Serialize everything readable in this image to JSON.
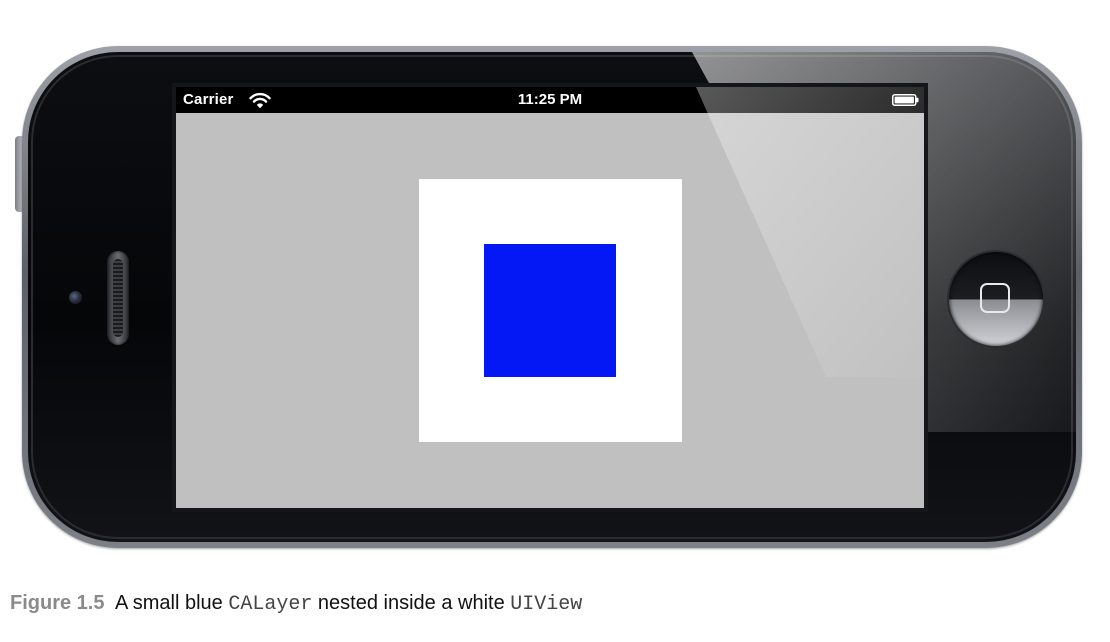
{
  "status_bar": {
    "carrier": "Carrier",
    "time": "11:25 PM",
    "icons": [
      "wifi-icon",
      "battery-icon"
    ]
  },
  "colors": {
    "screen_background": "#c0c0c0",
    "white_view": "#ffffff",
    "blue_layer": "#0418f5",
    "status_bar": "#000000"
  },
  "caption": {
    "label": "Figure 1.5",
    "text_before": "A small blue",
    "code_1": "CALayer",
    "text_middle": "nested inside a white",
    "code_2": "UIView"
  }
}
